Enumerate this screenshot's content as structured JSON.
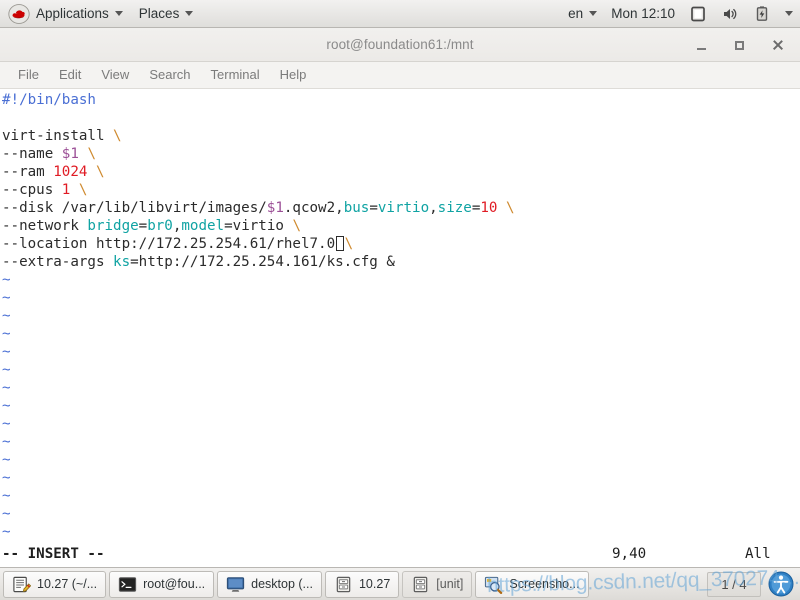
{
  "top_panel": {
    "logo_icon": "redhat-shadowman-icon",
    "applications_label": "Applications",
    "places_label": "Places",
    "keyboard_layout": "en",
    "clock": "Mon 12:10",
    "tray_icons": [
      "display-icon",
      "volume-icon",
      "battery-icon"
    ],
    "system_menu_caret": "caret-down-icon"
  },
  "window": {
    "title": "root@foundation61:/mnt",
    "controls": {
      "minimize": "minimize-icon",
      "maximize": "maximize-icon",
      "close": "close-icon"
    },
    "menubar": [
      "File",
      "Edit",
      "View",
      "Search",
      "Terminal",
      "Help"
    ]
  },
  "terminal": {
    "lines": [
      [
        {
          "t": "#!/bin/bash",
          "c": "c-comment"
        }
      ],
      [],
      [
        {
          "t": "virt-install ",
          "c": "c-plain"
        },
        {
          "t": "\\",
          "c": "c-cont"
        }
      ],
      [
        {
          "t": "--name ",
          "c": "c-plain"
        },
        {
          "t": "$1",
          "c": "c-var"
        },
        {
          "t": " ",
          "c": "c-plain"
        },
        {
          "t": "\\",
          "c": "c-cont"
        }
      ],
      [
        {
          "t": "--ram ",
          "c": "c-plain"
        },
        {
          "t": "1024",
          "c": "c-num"
        },
        {
          "t": " ",
          "c": "c-plain"
        },
        {
          "t": "\\",
          "c": "c-cont"
        }
      ],
      [
        {
          "t": "--cpus ",
          "c": "c-plain"
        },
        {
          "t": "1",
          "c": "c-num"
        },
        {
          "t": " ",
          "c": "c-plain"
        },
        {
          "t": "\\",
          "c": "c-cont"
        }
      ],
      [
        {
          "t": "--disk /var/lib/libvirt/images/",
          "c": "c-plain"
        },
        {
          "t": "$1",
          "c": "c-var"
        },
        {
          "t": ".qcow2,",
          "c": "c-plain"
        },
        {
          "t": "bus",
          "c": "c-ident"
        },
        {
          "t": "=",
          "c": "c-plain"
        },
        {
          "t": "virtio",
          "c": "c-ident"
        },
        {
          "t": ",",
          "c": "c-plain"
        },
        {
          "t": "size",
          "c": "c-ident"
        },
        {
          "t": "=",
          "c": "c-plain"
        },
        {
          "t": "10",
          "c": "c-num"
        },
        {
          "t": " ",
          "c": "c-plain"
        },
        {
          "t": "\\",
          "c": "c-cont"
        }
      ],
      [
        {
          "t": "--network ",
          "c": "c-plain"
        },
        {
          "t": "bridge",
          "c": "c-ident"
        },
        {
          "t": "=",
          "c": "c-plain"
        },
        {
          "t": "br0",
          "c": "c-ident"
        },
        {
          "t": ",",
          "c": "c-plain"
        },
        {
          "t": "model",
          "c": "c-ident"
        },
        {
          "t": "=",
          "c": "c-plain"
        },
        {
          "t": "virtio",
          "c": "c-plain"
        },
        {
          "t": " ",
          "c": "c-plain"
        },
        {
          "t": "\\",
          "c": "c-cont"
        }
      ],
      [
        {
          "t": "--location http://172.25.254.61/rhel7.0",
          "c": "c-plain"
        },
        {
          "t": "",
          "c": "cursor"
        },
        {
          "t": "\\",
          "c": "c-cont"
        }
      ],
      [
        {
          "t": "--extra-args ",
          "c": "c-plain"
        },
        {
          "t": "ks",
          "c": "c-ident"
        },
        {
          "t": "=http://172.25.254.161/ks.cfg &",
          "c": "c-plain"
        }
      ]
    ],
    "filler_char": "~",
    "filler_count": 15,
    "status": {
      "mode": "-- INSERT --",
      "ruler": "9,40",
      "position": "All"
    }
  },
  "taskbar": {
    "items": [
      {
        "icon": "text-editor-icon",
        "label": "10.27 (~/...",
        "active": true
      },
      {
        "icon": "terminal-icon",
        "label": "root@fou...",
        "active": true
      },
      {
        "icon": "monitor-icon",
        "label": "desktop (...",
        "active": true
      },
      {
        "icon": "archive-icon",
        "label": "10.27",
        "active": true
      },
      {
        "icon": "archive-icon",
        "label": "[unit]",
        "active": false
      },
      {
        "icon": "screenshot-icon",
        "label": "Screensho...",
        "active": true
      }
    ],
    "workspace": "1 / 4",
    "end_icon": "accessibility-icon"
  },
  "watermark": {
    "text": "https://blog.csdn.net/qq_370274…"
  }
}
